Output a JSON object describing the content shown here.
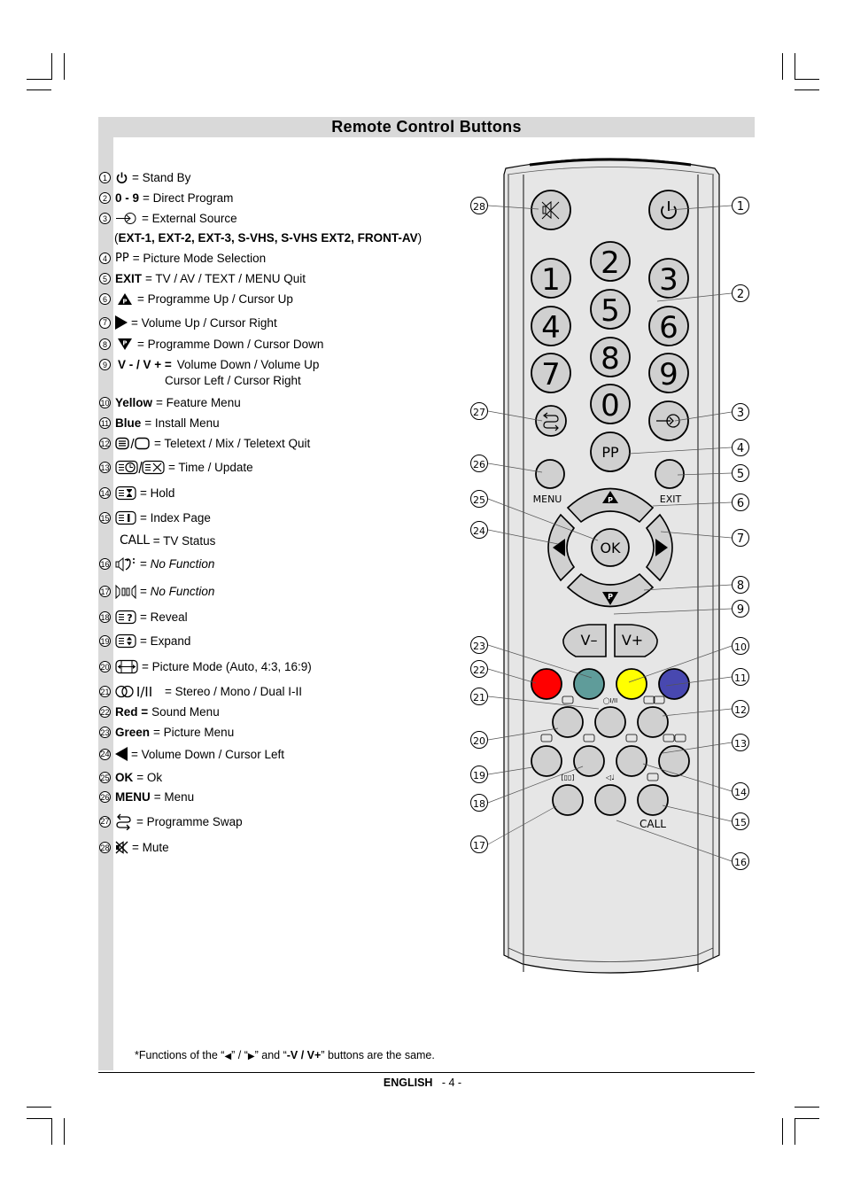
{
  "page": {
    "title": "Remote Control Buttons",
    "language": "ENGLISH",
    "page_number": "- 4 -",
    "footnote": {
      "prefix": "*Functions of the “",
      "left_arrow": "◀",
      "mid1": "” / “",
      "right_arrow": "▶",
      "mid2": "” and “",
      "bold": "-V / V+",
      "suffix": "” buttons are the same."
    }
  },
  "legend": [
    {
      "n": "1",
      "icon": "power-icon",
      "key": "",
      "desc": "= Stand By"
    },
    {
      "n": "2",
      "icon": "",
      "key": "0 - 9",
      "desc": "= Direct Program"
    },
    {
      "n": "3",
      "icon": "external-source-icon",
      "key": "",
      "desc": "= External Source",
      "extra": "EXT-1, EXT-2, EXT-3, S-VHS, S-VHS EXT2, FRONT-AV"
    },
    {
      "n": "4",
      "icon": "",
      "key_plain": "PP",
      "desc": "= Picture Mode Selection"
    },
    {
      "n": "5",
      "icon": "",
      "key": "EXIT",
      "desc": "= TV / AV / TEXT / MENU Quit"
    },
    {
      "n": "6",
      "icon": "programme-up-icon",
      "key": "",
      "desc": "= Programme Up / Cursor Up"
    },
    {
      "n": "7",
      "icon": "right-triangle-icon",
      "key": "",
      "desc": "= Volume Up / Cursor Right"
    },
    {
      "n": "8",
      "icon": "programme-down-icon",
      "key": "",
      "desc": "= Programme Down / Cursor Down"
    },
    {
      "n": "9",
      "icon": "",
      "key": "V - / V + =",
      "desc": "Volume Down / Volume Up",
      "desc2": "Cursor Left / Cursor Right"
    },
    {
      "n": "10",
      "icon": "",
      "key": "Yellow",
      "desc": "= Feature Menu"
    },
    {
      "n": "11",
      "icon": "",
      "key": "Blue",
      "desc": "= Install Menu"
    },
    {
      "n": "12",
      "icon": "teletext-mix-icon",
      "key": "",
      "desc": "= Teletext / Mix / Teletext Quit"
    },
    {
      "n": "13",
      "icon": "time-update-icon",
      "key": "",
      "desc": "= Time / Update"
    },
    {
      "n": "14",
      "icon": "hold-icon",
      "key": "",
      "desc": "= Hold"
    },
    {
      "n": "15",
      "icon": "index-page-icon",
      "key": "",
      "desc": "= Index Page",
      "extra_key": "CALL",
      "extra_desc": "= TV Status"
    },
    {
      "n": "16",
      "icon": "sound-effect-icon",
      "key": "",
      "desc": "= ",
      "desc_italic": "No Function"
    },
    {
      "n": "17",
      "icon": "surround-icon",
      "key": "",
      "desc": "= ",
      "desc_italic": "No Function"
    },
    {
      "n": "18",
      "icon": "reveal-icon",
      "key": "",
      "desc": "= Reveal"
    },
    {
      "n": "19",
      "icon": "expand-icon",
      "key": "",
      "desc": "= Expand"
    },
    {
      "n": "20",
      "icon": "picture-mode-icon",
      "key": "",
      "desc": "= Picture Mode (Auto, 4:3, 16:9)"
    },
    {
      "n": "21",
      "icon": "stereo-dual-icon",
      "key": "",
      "desc": "= Stereo / Mono / Dual I-II"
    },
    {
      "n": "22",
      "icon": "",
      "key": "Red =",
      "desc": "Sound Menu"
    },
    {
      "n": "23",
      "icon": "",
      "key": "Green",
      "desc": "= Picture Menu"
    },
    {
      "n": "24",
      "icon": "left-triangle-icon",
      "key": "",
      "desc": "= Volume Down / Cursor Left"
    },
    {
      "n": "25",
      "icon": "",
      "key": "OK",
      "desc": "= Ok"
    },
    {
      "n": "26",
      "icon": "",
      "key": "MENU",
      "desc": "= Menu"
    },
    {
      "n": "27",
      "icon": "programme-swap-icon",
      "key": "",
      "desc": "= Programme Swap"
    },
    {
      "n": "28",
      "icon": "mute-icon",
      "key": "",
      "desc": "= Mute"
    }
  ],
  "remote": {
    "digits": [
      "1",
      "2",
      "3",
      "4",
      "5",
      "6",
      "7",
      "8",
      "9",
      "0"
    ],
    "labels": {
      "pp": "PP",
      "menu": "MENU",
      "exit": "EXIT",
      "ok": "OK",
      "p": "P",
      "v_minus": "V–",
      "v_plus": "V+",
      "call": "CALL",
      "stereo": "I/II"
    },
    "colors": {
      "red": "#ff0000",
      "green": "#5f9c9a",
      "yellow": "#ffff00",
      "blue": "#4848b0",
      "body": "#e6e6e6",
      "button": "#d0d0d0",
      "panel": "#d9d9d9"
    },
    "callouts_right": [
      "1",
      "2",
      "3",
      "4",
      "5",
      "6",
      "7",
      "8",
      "9",
      "10",
      "11",
      "12",
      "13",
      "14",
      "15",
      "16"
    ],
    "callouts_left": [
      "28",
      "27",
      "26",
      "25",
      "24",
      "23",
      "22",
      "21",
      "20",
      "19",
      "18",
      "17"
    ]
  }
}
